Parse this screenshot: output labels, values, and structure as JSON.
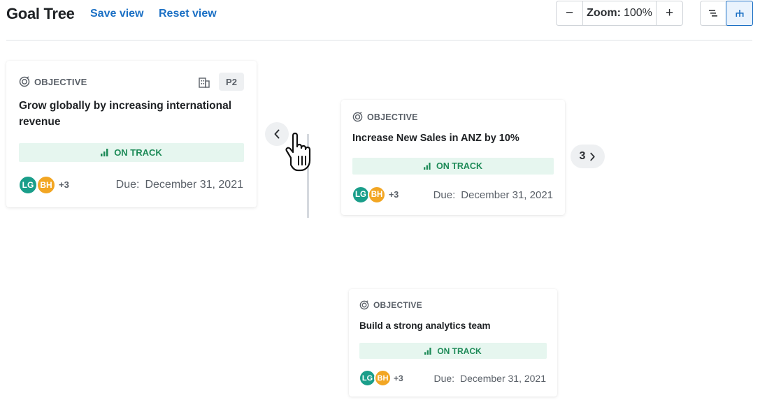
{
  "header": {
    "title": "Goal Tree",
    "save_view": "Save view",
    "reset_view": "Reset view",
    "zoom_minus": "−",
    "zoom_label": "Zoom:",
    "zoom_value": "100%",
    "zoom_plus": "+"
  },
  "cards": [
    {
      "type": "OBJECTIVE",
      "priority": "P2",
      "title": "Grow globally by increasing international revenue",
      "status": "ON TRACK",
      "avatars": [
        "LG",
        "BH"
      ],
      "more": "+3",
      "due_label": "Due:",
      "due_date": "December 31, 2021"
    },
    {
      "type": "OBJECTIVE",
      "title": "Increase New Sales in ANZ by 10%",
      "status": "ON TRACK",
      "avatars": [
        "LG",
        "BH"
      ],
      "more": "+3",
      "due_label": "Due:",
      "due_date": "December 31, 2021",
      "children_count": "3"
    },
    {
      "type": "OBJECTIVE",
      "title": "Build a strong analytics team",
      "status": "ON TRACK",
      "avatars": [
        "LG",
        "BH"
      ],
      "more": "+3",
      "due_label": "Due:",
      "due_date": "December 31, 2021"
    }
  ],
  "colors": {
    "link": "#1a6fc4",
    "on_track_bg": "#e6f6ef",
    "on_track_text": "#1d8a57",
    "avatar_lg": "#1a9e8a",
    "avatar_bh": "#f2a623"
  },
  "icons": [
    "target-icon",
    "building-icon",
    "bar-chart-icon",
    "chevron-left-icon",
    "chevron-right-icon",
    "list-view-icon",
    "tree-view-icon",
    "hand-cursor-icon"
  ]
}
